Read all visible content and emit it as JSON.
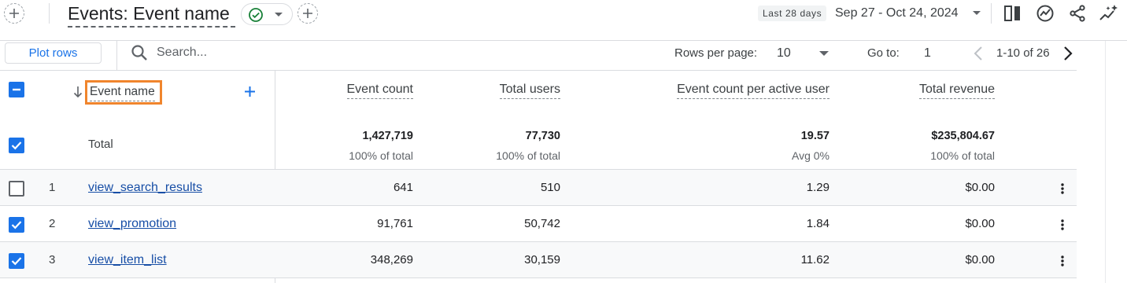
{
  "header": {
    "title": "Events: Event name",
    "date_chip": "Last 28 days",
    "date_range": "Sep 27 - Oct 24, 2024"
  },
  "toolbar": {
    "plot_rows_label": "Plot rows",
    "search_placeholder": "Search...",
    "rows_per_page_label": "Rows per page:",
    "rows_per_page_value": "10",
    "goto_label": "Go to:",
    "goto_value": "1",
    "page_range": "1-10 of 26"
  },
  "table": {
    "columns": {
      "dimension": "Event name",
      "event_count": "Event count",
      "total_users": "Total users",
      "per_user": "Event count per active user",
      "revenue": "Total revenue"
    },
    "totals": {
      "label": "Total",
      "event_count": "1,427,719",
      "event_count_sub": "100% of total",
      "total_users": "77,730",
      "total_users_sub": "100% of total",
      "per_user": "19.57",
      "per_user_sub": "Avg 0%",
      "revenue": "$235,804.67",
      "revenue_sub": "100% of total"
    },
    "rows": [
      {
        "index": "1",
        "name": "view_search_results",
        "event_count": "641",
        "total_users": "510",
        "per_user": "1.29",
        "revenue": "$0.00",
        "checked": false
      },
      {
        "index": "2",
        "name": "view_promotion",
        "event_count": "91,761",
        "total_users": "50,742",
        "per_user": "1.84",
        "revenue": "$0.00",
        "checked": true
      },
      {
        "index": "3",
        "name": "view_item_list",
        "event_count": "348,269",
        "total_users": "30,159",
        "per_user": "11.62",
        "revenue": "$0.00",
        "checked": true
      }
    ]
  },
  "colors": {
    "accent": "#1a73e8",
    "highlight_box": "#f0852d",
    "link": "#174ea6",
    "success_check": "#188038"
  }
}
